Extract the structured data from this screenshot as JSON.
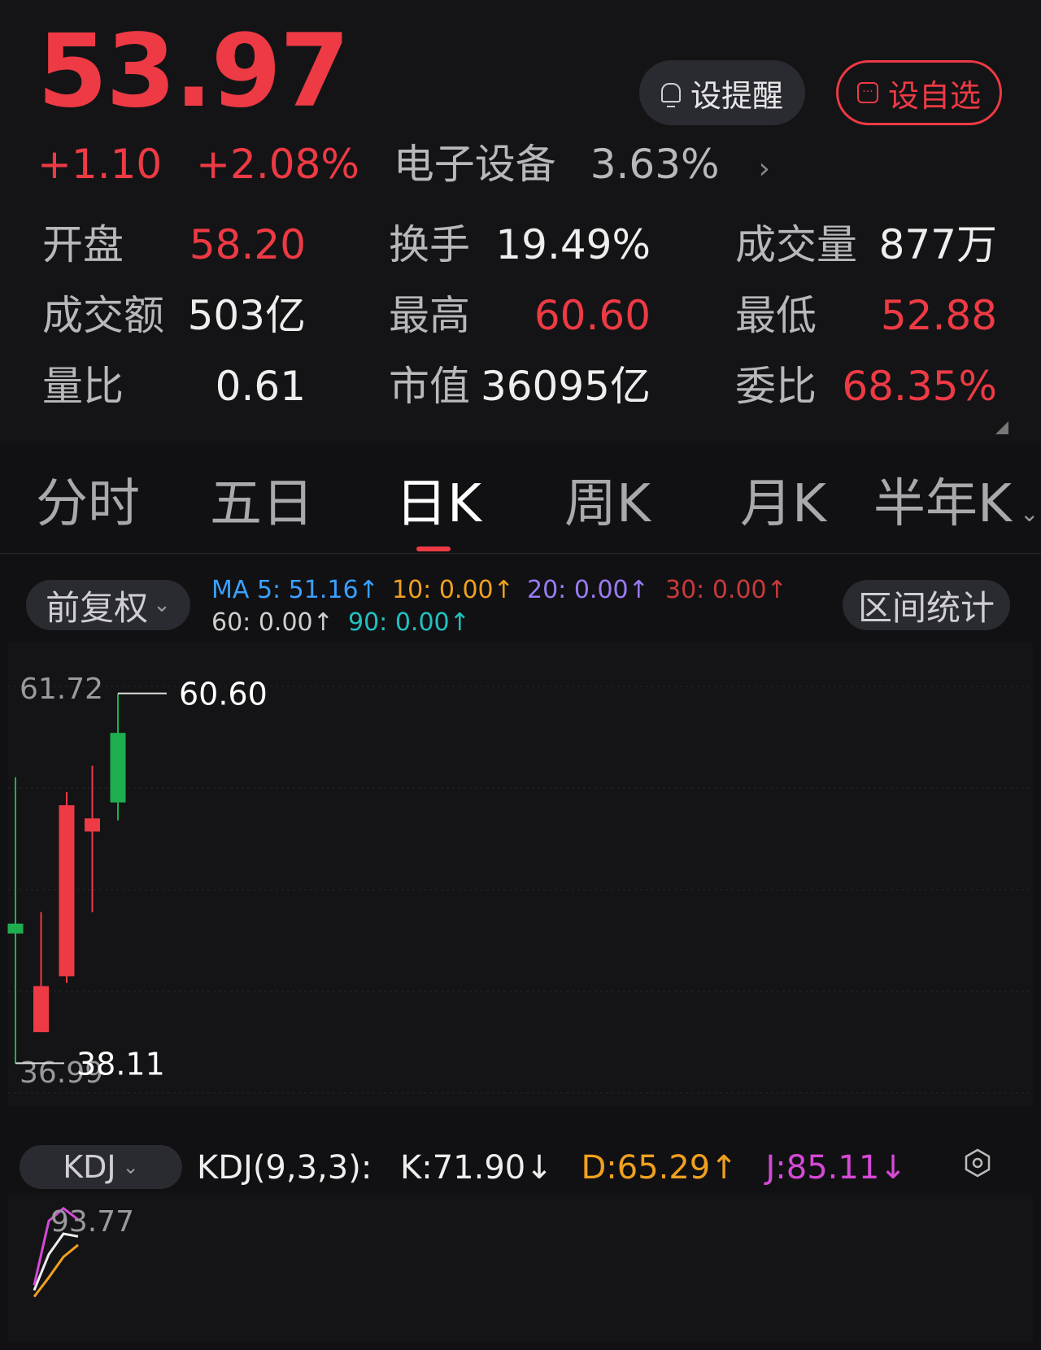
{
  "quote": {
    "price": "53.97",
    "change": "+1.10",
    "change_pct": "+2.08%",
    "sector_name": "电子设备",
    "sector_pct": "3.63%",
    "sector_chevron": "›",
    "remind_label": "设提醒",
    "watch_label": "设自选",
    "stats": {
      "open_label": "开盘",
      "open_value": "58.20",
      "turnover_label": "换手",
      "turnover_value": "19.49%",
      "volume_label": "成交量",
      "volume_value": "877万",
      "amount_label": "成交额",
      "amount_value": "503亿",
      "high_label": "最高",
      "high_value": "60.60",
      "low_label": "最低",
      "low_value": "52.88",
      "vol_ratio_label": "量比",
      "vol_ratio_value": "0.61",
      "mktcap_label": "市值",
      "mktcap_value": "36095亿",
      "bid_ratio_label": "委比",
      "bid_ratio_value": "68.35%"
    }
  },
  "tabs": [
    {
      "label": "分时"
    },
    {
      "label": "五日"
    },
    {
      "label": "日K"
    },
    {
      "label": "周K"
    },
    {
      "label": "月K"
    },
    {
      "label": "半年K"
    }
  ],
  "tab_more_chevron": "⌄",
  "toolbar": {
    "adjust_label": "前复权",
    "adjust_chevron": "⌄",
    "range_stats_label": "区间统计",
    "ma": {
      "ma5": "MA 5: 51.16↑",
      "ma10": "10: 0.00↑",
      "ma20": "20: 0.00↑",
      "ma30": "30: 0.00↑",
      "ma60": "60: 0.00↑",
      "ma90": "90: 0.00↑"
    }
  },
  "colors": {
    "up": "#ee3a44",
    "down": "#1fae4f",
    "ma5": "#3aa0ff",
    "ma10": "#f0a020",
    "ma20": "#9b7cf2",
    "ma30": "#c83a3a",
    "ma60": "#cfcfcf",
    "ma90": "#22c1c1",
    "kdj_k": "#eeeeee",
    "kdj_d": "#f0a020",
    "kdj_j": "#d649d6"
  },
  "kline": {
    "axis_max_label": "61.72",
    "axis_min_label": "36.99",
    "high_marker": "60.60",
    "low_marker": "38.11",
    "y_range": [
      36.99,
      61.72
    ],
    "candles": [
      {
        "open": 46.6,
        "close": 46.0,
        "high": 55.5,
        "low": 38.11
      },
      {
        "open": 40.0,
        "close": 42.8,
        "high": 47.3,
        "low": 40.0
      },
      {
        "open": 43.4,
        "close": 53.8,
        "high": 54.6,
        "low": 43.0
      },
      {
        "open": 52.2,
        "close": 53.0,
        "high": 56.2,
        "low": 47.3
      },
      {
        "open": 58.2,
        "close": 53.97,
        "high": 60.6,
        "low": 52.88
      }
    ]
  },
  "kdj": {
    "chip_label": "KDJ",
    "chip_chevron": "⌄",
    "title": "KDJ(9,3,3):",
    "k_text": "K:71.90↓",
    "d_text": "D:65.29↑",
    "j_text": "J:85.11↓",
    "axis_max_label": "93.77",
    "y_range": [
      0,
      100
    ],
    "k": [
      30,
      58,
      74,
      71.9
    ],
    "d": [
      25,
      40,
      56,
      65.29
    ],
    "j": [
      34,
      84,
      93.77,
      85.11
    ],
    "settings_icon": "hexagon-gear-icon"
  }
}
